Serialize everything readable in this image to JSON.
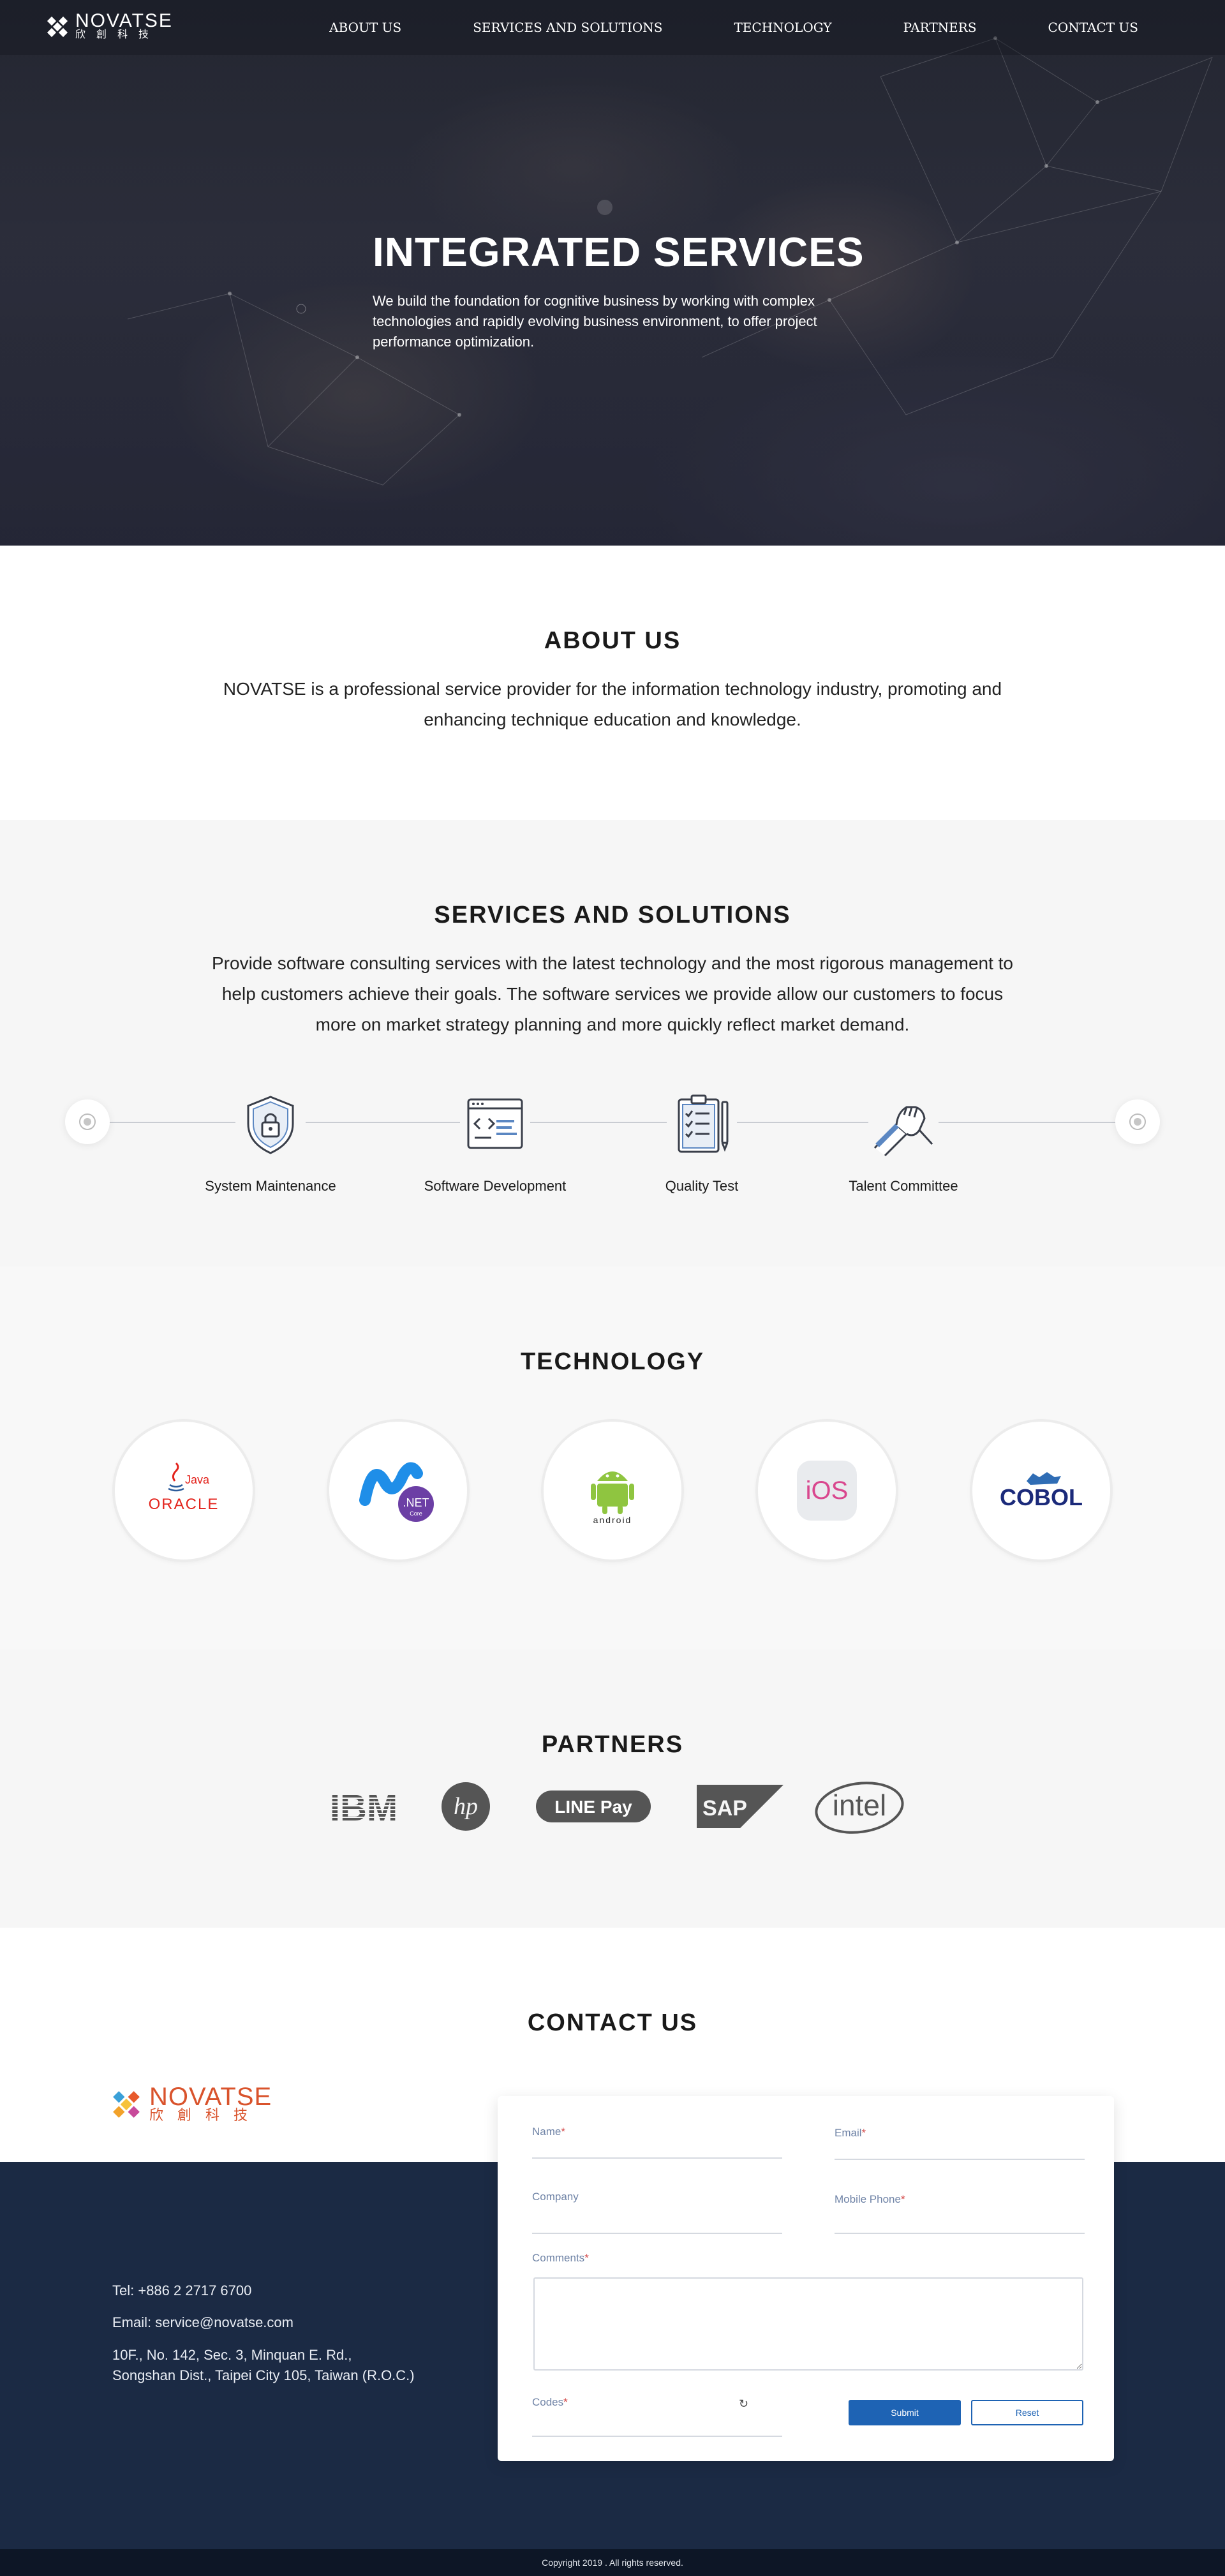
{
  "brand": {
    "name_en": "NOVATSE",
    "name_zh": "欣創科技"
  },
  "nav": {
    "items": [
      {
        "label": "ABOUT US"
      },
      {
        "label": "SERVICES AND SOLUTIONS"
      },
      {
        "label": "TECHNOLOGY"
      },
      {
        "label": "PARTNERS"
      },
      {
        "label": "CONTACT US"
      }
    ]
  },
  "hero": {
    "title": "INTEGRATED SERVICES",
    "description": "We build the foundation for cognitive business by working with complex technologies and rapidly evolving business environment, to offer project performance optimization."
  },
  "about": {
    "title": "ABOUT US",
    "text": "NOVATSE is a professional service provider for the information technology industry, promoting and enhancing technique education and knowledge."
  },
  "services": {
    "title": "SERVICES AND SOLUTIONS",
    "text": "Provide software consulting services with the latest technology and the most rigorous management to help customers achieve their goals. The software services we provide allow our customers to focus more on market strategy planning and more quickly reflect market demand.",
    "items": [
      {
        "label": "System Maintenance",
        "icon": "shield-lock-icon"
      },
      {
        "label": "Software Development",
        "icon": "code-window-icon"
      },
      {
        "label": "Quality Test",
        "icon": "clipboard-checklist-icon"
      },
      {
        "label": "Talent Committee",
        "icon": "handshake-icon"
      }
    ]
  },
  "technology": {
    "title": "TECHNOLOGY",
    "items": [
      {
        "name": "Java",
        "sub": "ORACLE",
        "icon": "java-oracle-logo"
      },
      {
        "name": ".NET",
        "sub": "Core",
        "icon": "dotnet-logo"
      },
      {
        "name": "android",
        "icon": "android-logo"
      },
      {
        "name": "iOS",
        "icon": "ios-logo"
      },
      {
        "name": "COBOL",
        "icon": "cobol-logo"
      }
    ]
  },
  "partners": {
    "title": "PARTNERS",
    "items": [
      {
        "name": "IBM",
        "icon": "ibm-logo"
      },
      {
        "name": "hp",
        "icon": "hp-logo"
      },
      {
        "name": "LINE Pay",
        "icon": "linepay-logo"
      },
      {
        "name": "SAP",
        "icon": "sap-logo"
      },
      {
        "name": "intel",
        "icon": "intel-logo"
      }
    ]
  },
  "contact": {
    "title": "CONTACT US",
    "tel": "Tel: +886 2 2717 6700",
    "email": "Email: service@novatse.com",
    "address_line1": "10F., No. 142, Sec. 3, Minquan E. Rd.,",
    "address_line2": "Songshan Dist., Taipei City 105, Taiwan (R.O.C.)",
    "form": {
      "name_label": "Name",
      "email_label": "Email",
      "company_label": "Company",
      "mobile_label": "Mobile Phone",
      "comments_label": "Comments",
      "codes_label": "Codes",
      "required_mark": "*",
      "submit_label": "Submit",
      "reset_label": "Reset",
      "refresh_glyph": "↻"
    }
  },
  "footer": {
    "copyright": "Copyright 2019 . All rights reserved."
  },
  "colors": {
    "accent": "#1e63b4",
    "footer_bg": "#1b2a44",
    "brand_orange": "#d9532c",
    "label_blue": "#6f83a6",
    "required_red": "#d34a4a"
  }
}
